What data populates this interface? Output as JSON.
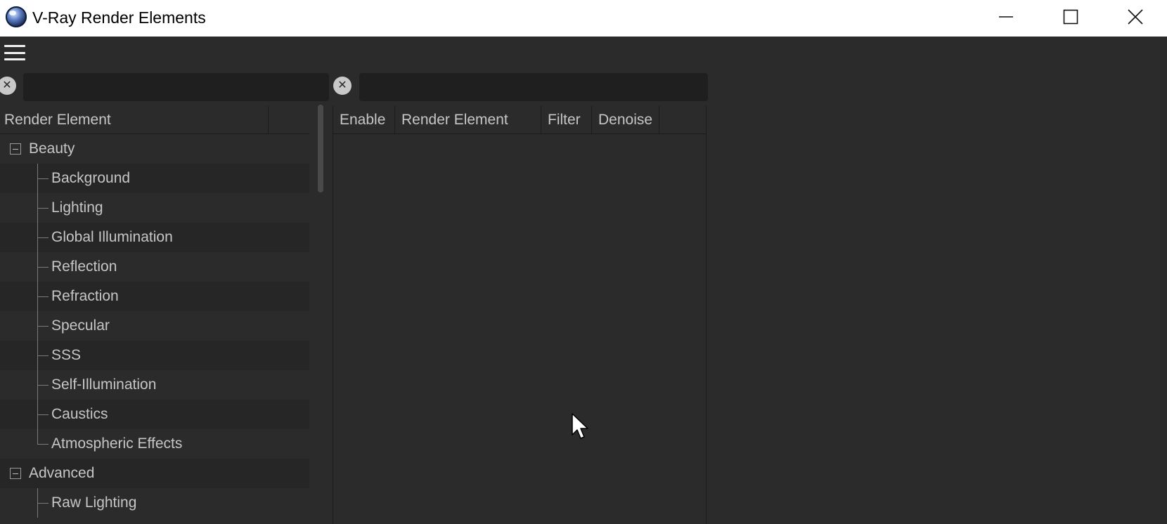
{
  "window": {
    "title": "V-Ray Render Elements",
    "controls": {
      "minimize": "minimize-icon",
      "maximize": "maximize-icon",
      "close": "close-icon"
    }
  },
  "toolbar": {
    "menu_icon": "hamburger-menu-icon"
  },
  "left_panel": {
    "search_value": "",
    "header": "Render Element",
    "tree": [
      {
        "label": "Beauty",
        "type": "group"
      },
      {
        "label": "Background",
        "type": "child"
      },
      {
        "label": "Lighting",
        "type": "child"
      },
      {
        "label": "Global Illumination",
        "type": "child"
      },
      {
        "label": "Reflection",
        "type": "child"
      },
      {
        "label": "Refraction",
        "type": "child"
      },
      {
        "label": "Specular",
        "type": "child"
      },
      {
        "label": "SSS",
        "type": "child"
      },
      {
        "label": "Self-Illumination",
        "type": "child"
      },
      {
        "label": "Caustics",
        "type": "child"
      },
      {
        "label": "Atmospheric Effects",
        "type": "child_last"
      },
      {
        "label": "Advanced",
        "type": "group"
      },
      {
        "label": "Raw Lighting",
        "type": "child"
      }
    ]
  },
  "right_panel": {
    "search_value": "",
    "columns": [
      "Enable",
      "Render Element",
      "Filter",
      "Denoise"
    ],
    "rows": []
  },
  "colors": {
    "background": "#2b2b2b",
    "text": "#c6c6c6",
    "titlebar": "#ffffff"
  }
}
